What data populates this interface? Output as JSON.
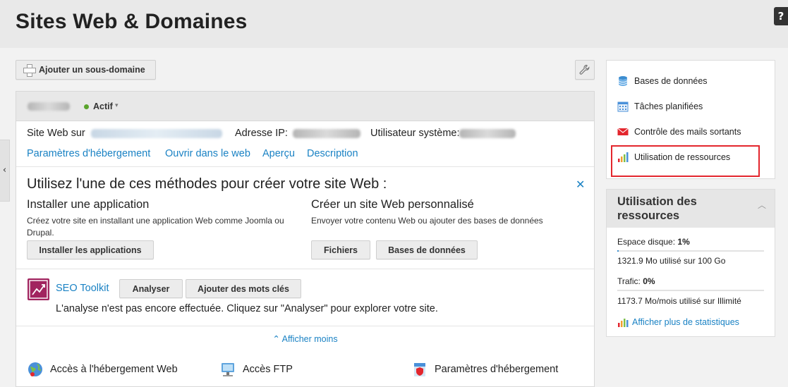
{
  "header": {
    "title": "Sites Web & Domaines",
    "help_label": "?"
  },
  "toolbar": {
    "add_subdomain_label": "Ajouter un sous-domaine"
  },
  "domain": {
    "status": "Actif",
    "site_label": "Site Web sur",
    "ip_label": "Adresse IP:",
    "user_label": "Utilisateur système:",
    "links": [
      "Paramètres d'hébergement",
      "Ouvrir dans le web",
      "Aperçu",
      "Description"
    ],
    "status_color": "#5aa42c"
  },
  "create": {
    "title": "Utilisez l'une de ces méthodes pour créer votre site Web :",
    "app_title": "Installer une application",
    "app_desc": "Créez votre site en installant une application Web comme Joomla ou Drupal.",
    "app_button": "Installer les applications",
    "custom_title": "Créer un site Web personnalisé",
    "custom_desc": "Envoyer votre contenu Web ou ajouter des bases de données",
    "files_button": "Fichiers",
    "db_button": "Bases de données"
  },
  "seo": {
    "name": "SEO Toolkit",
    "analyze_button": "Analyser",
    "keywords_button": "Ajouter des mots clés",
    "message": "L'analyse n'est pas encore effectuée. Cliquez sur \"Analyser\" pour explorer votre site."
  },
  "show_less": "Afficher moins",
  "bottom_items": [
    "Accès à l'hébergement Web",
    "Accès FTP",
    "Paramètres d'hébergement"
  ],
  "right_menu": {
    "items": [
      "Bases de données",
      "Tâches planifiées",
      "Contrôle des mails sortants",
      "Utilisation de ressources"
    ],
    "highlight_color": "#e3262d"
  },
  "resources": {
    "title": "Utilisation des ressources",
    "disk_label": "Espace disque:",
    "disk_value": "1%",
    "disk_fraction": 0.01,
    "disk_detail": "1321.9 Mo utilisé sur 100 Go",
    "traffic_label": "Trafic:",
    "traffic_value": "0%",
    "traffic_fraction": 0.0,
    "traffic_detail": "1173.7 Mo/mois utilisé sur Illimité",
    "stats_link": "Afficher plus de statistiques"
  },
  "colors": {
    "link": "#1a82c4",
    "accent_red": "#e3262d"
  }
}
